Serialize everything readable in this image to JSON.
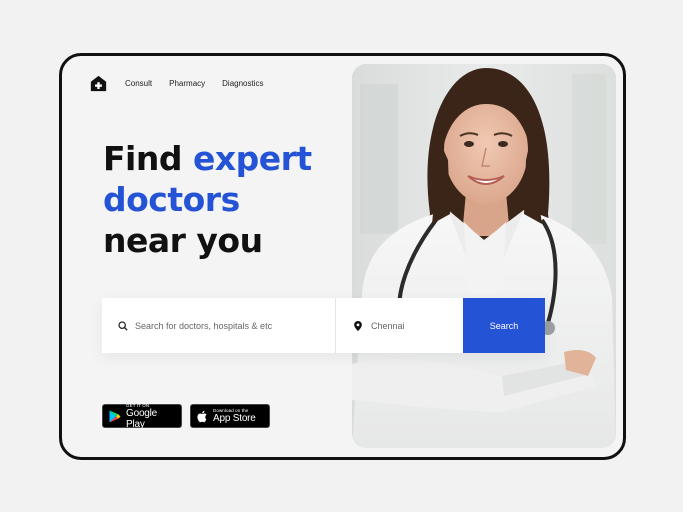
{
  "nav": {
    "logo_icon": "home-plus-icon",
    "links": [
      "Consult",
      "Pharmacy",
      "Diagnostics"
    ]
  },
  "hero": {
    "line1_plain": "Find",
    "line1_accent": "expert",
    "line2_accent": "doctors",
    "line3_plain": "near you",
    "accent_color": "#2453d6"
  },
  "search": {
    "query_placeholder": "Search for doctors, hospitals & etc",
    "query_icon": "search-icon",
    "location_value": "Chennai",
    "location_icon": "location-pin-icon",
    "button_label": "Search",
    "button_color": "#2453d6"
  },
  "stores": {
    "google_play_small": "GET IT ON",
    "google_play_big": "Google Play",
    "app_store_small": "Download on the",
    "app_store_big": "App Store"
  }
}
